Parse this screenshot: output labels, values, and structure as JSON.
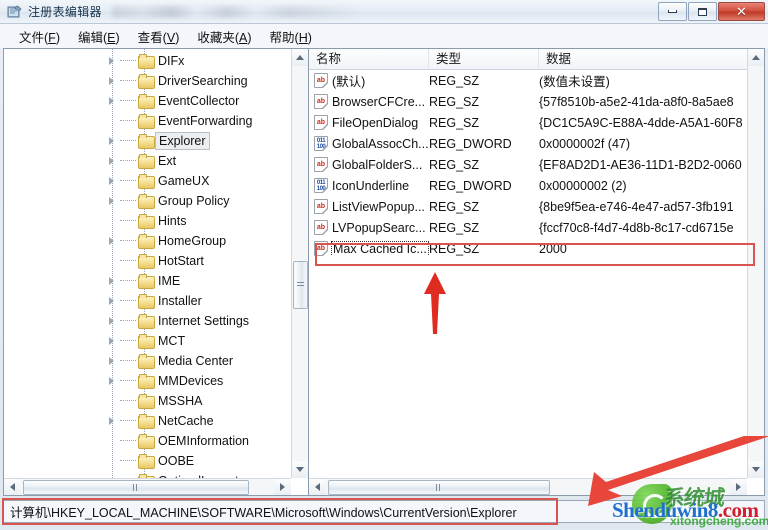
{
  "window": {
    "title": "注册表编辑器",
    "icon": "registry-editor-icon",
    "controls": {
      "minimize": "最小化",
      "maximize": "最大化",
      "close": "✕"
    }
  },
  "menubar": {
    "items": [
      {
        "label": "文件(F)",
        "accel": "F"
      },
      {
        "label": "编辑(E)",
        "accel": "E"
      },
      {
        "label": "查看(V)",
        "accel": "V"
      },
      {
        "label": "收藏夹(A)",
        "accel": "A"
      },
      {
        "label": "帮助(H)",
        "accel": "H"
      }
    ]
  },
  "tree": {
    "items": [
      {
        "label": "DIFx",
        "expandable": true,
        "selected": false
      },
      {
        "label": "DriverSearching",
        "expandable": true,
        "selected": false
      },
      {
        "label": "EventCollector",
        "expandable": true,
        "selected": false
      },
      {
        "label": "EventForwarding",
        "expandable": false,
        "selected": false
      },
      {
        "label": "Explorer",
        "expandable": true,
        "selected": true
      },
      {
        "label": "Ext",
        "expandable": true,
        "selected": false
      },
      {
        "label": "GameUX",
        "expandable": true,
        "selected": false
      },
      {
        "label": "Group Policy",
        "expandable": true,
        "selected": false
      },
      {
        "label": "Hints",
        "expandable": false,
        "selected": false
      },
      {
        "label": "HomeGroup",
        "expandable": true,
        "selected": false
      },
      {
        "label": "HotStart",
        "expandable": false,
        "selected": false
      },
      {
        "label": "IME",
        "expandable": true,
        "selected": false
      },
      {
        "label": "Installer",
        "expandable": true,
        "selected": false
      },
      {
        "label": "Internet Settings",
        "expandable": true,
        "selected": false
      },
      {
        "label": "MCT",
        "expandable": true,
        "selected": false
      },
      {
        "label": "Media Center",
        "expandable": true,
        "selected": false
      },
      {
        "label": "MMDevices",
        "expandable": true,
        "selected": false
      },
      {
        "label": "MSSHA",
        "expandable": false,
        "selected": false
      },
      {
        "label": "NetCache",
        "expandable": true,
        "selected": false
      },
      {
        "label": "OEMInformation",
        "expandable": false,
        "selected": false
      },
      {
        "label": "OOBE",
        "expandable": false,
        "selected": false
      },
      {
        "label": "OptimalLayout",
        "expandable": false,
        "selected": false
      }
    ]
  },
  "list": {
    "columns": [
      "名称",
      "类型",
      "数据"
    ],
    "rows": [
      {
        "name": "(默认)",
        "type": "REG_SZ",
        "data": "(数值未设置)",
        "icon": "string-value-icon",
        "focused": false,
        "annotated": false
      },
      {
        "name": "BrowserCFCre...",
        "type": "REG_SZ",
        "data": "{57f8510b-a5e2-41da-a8f0-8a5ae8",
        "icon": "string-value-icon",
        "focused": false,
        "annotated": false
      },
      {
        "name": "FileOpenDialog",
        "type": "REG_SZ",
        "data": "{DC1C5A9C-E88A-4dde-A5A1-60F8",
        "icon": "string-value-icon",
        "focused": false,
        "annotated": false
      },
      {
        "name": "GlobalAssocCh...",
        "type": "REG_DWORD",
        "data": "0x0000002f (47)",
        "icon": "dword-value-icon",
        "focused": false,
        "annotated": false
      },
      {
        "name": "GlobalFolderS...",
        "type": "REG_SZ",
        "data": "{EF8AD2D1-AE36-11D1-B2D2-0060",
        "icon": "string-value-icon",
        "focused": false,
        "annotated": false
      },
      {
        "name": "IconUnderline",
        "type": "REG_DWORD",
        "data": "0x00000002 (2)",
        "icon": "dword-value-icon",
        "focused": false,
        "annotated": false
      },
      {
        "name": "ListViewPopup...",
        "type": "REG_SZ",
        "data": "{8be9f5ea-e746-4e47-ad57-3fb191",
        "icon": "string-value-icon",
        "focused": false,
        "annotated": false
      },
      {
        "name": "LVPopupSearc...",
        "type": "REG_SZ",
        "data": "{fccf70c8-f4d7-4d8b-8c17-cd6715e",
        "icon": "string-value-icon",
        "focused": false,
        "annotated": false
      },
      {
        "name": "Max Cached Ic...",
        "type": "REG_SZ",
        "data": "2000",
        "icon": "string-value-icon",
        "focused": true,
        "annotated": true
      }
    ]
  },
  "statusbar": {
    "path": "计算机\\HKEY_LOCAL_MACHINE\\SOFTWARE\\Microsoft\\Windows\\CurrentVersion\\Explorer"
  },
  "annotations": {
    "color": "#d9534f",
    "highlight_row_label": "Max Cached Icons 行标注框",
    "highlight_status_label": "注册表路径标注框",
    "arrow_up_label": "指向 Max Cached Icons 的红色箭头",
    "arrow_diagonal_label": "指向状态栏路径的红色箭头"
  },
  "watermarks": {
    "primary": "Shenduwin8.com",
    "secondary": "xitongcheng.com",
    "chinese": "系统城"
  },
  "scrollbars": {
    "tree_vertical": "tree-vertical-scrollbar",
    "tree_horizontal": "tree-horizontal-scrollbar",
    "list_vertical": "list-vertical-scrollbar",
    "list_horizontal": "list-horizontal-scrollbar"
  }
}
